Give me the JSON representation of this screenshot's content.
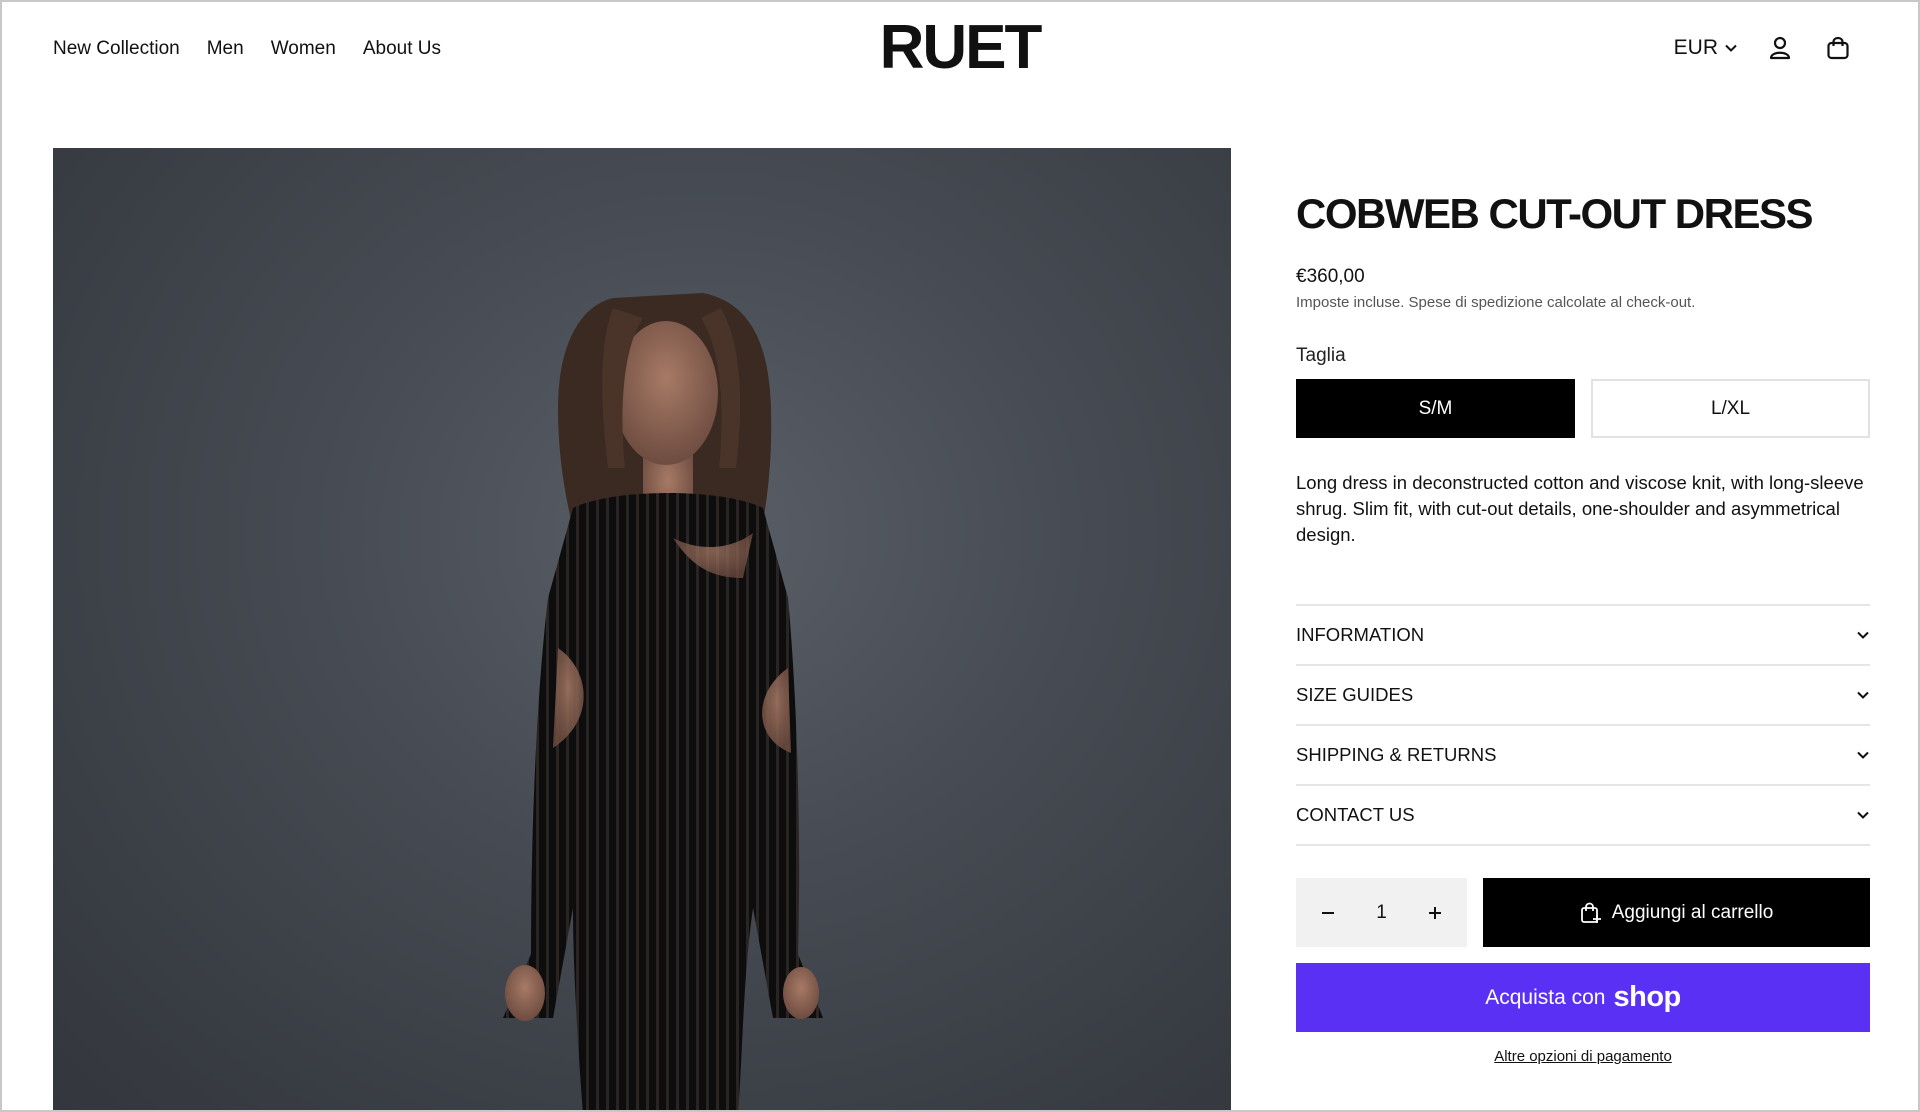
{
  "header": {
    "nav": [
      "New Collection",
      "Men",
      "Women",
      "About Us"
    ],
    "logo": "RUET",
    "currency": "EUR"
  },
  "product": {
    "title": "COBWEB CUT-OUT DRESS",
    "price": "€360,00",
    "tax_note": "Imposte incluse. Spese di spedizione calcolate al check-out.",
    "size_label": "Taglia",
    "sizes": [
      {
        "label": "S/M",
        "selected": true
      },
      {
        "label": "L/XL",
        "selected": false
      }
    ],
    "description": "Long dress in deconstructed cotton and viscose knit, with long-sleeve shrug. Slim fit, with cut-out details, one-shoulder and asymmetrical design.",
    "accordion": [
      "INFORMATION",
      "SIZE GUIDES",
      "SHIPPING & RETURNS",
      "CONTACT US"
    ],
    "quantity": "1",
    "add_to_cart": "Aggiungi al carrello",
    "shop_pay_prefix": "Acquista con",
    "shop_pay_brand": "shop",
    "other_payment": "Altre opzioni di pagamento"
  },
  "colors": {
    "shop_pay": "#5a31f4",
    "primary": "#000000",
    "background_photo": "#474c54"
  }
}
